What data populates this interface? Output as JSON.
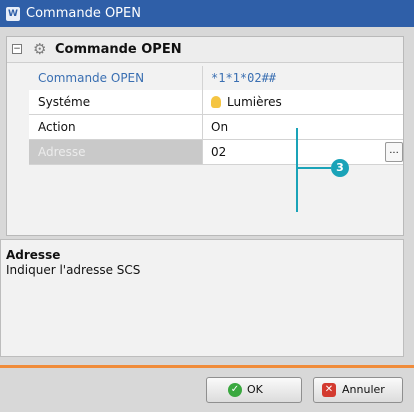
{
  "window": {
    "title": "Commande OPEN",
    "app_icon": "app-logo-icon"
  },
  "group": {
    "title": "Commande OPEN",
    "collapse_symbol": "−",
    "icon": "gear-icon"
  },
  "properties": [
    {
      "name": "Commande OPEN",
      "value": "*1*1*02##"
    },
    {
      "name": "Systéme",
      "value": "Lumières",
      "icon": "bulb-icon"
    },
    {
      "name": "Action",
      "value": "On"
    },
    {
      "name": "Adresse",
      "value": "02",
      "button": "..."
    }
  ],
  "callout": {
    "number": "3",
    "color": "#1aa3b8"
  },
  "help": {
    "title": "Adresse",
    "text": "Indiquer l'adresse SCS"
  },
  "buttons": {
    "ok": "OK",
    "cancel": "Annuler"
  },
  "colors": {
    "titlebar": "#2f5fa8",
    "accent_line": "#f08c3a",
    "link_text": "#3a6fb2"
  }
}
